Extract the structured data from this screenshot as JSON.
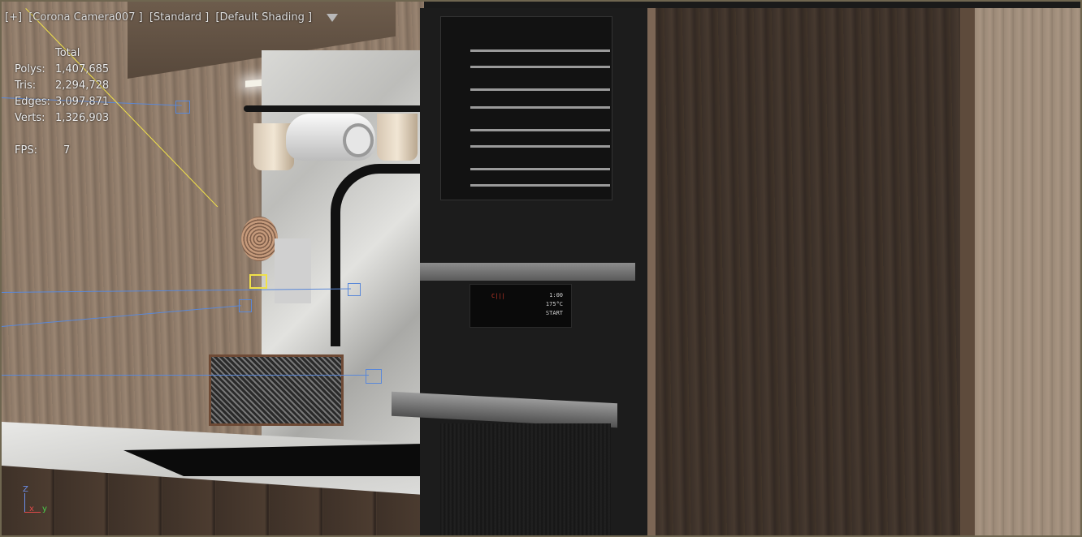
{
  "viewport": {
    "label_segments": [
      "[+]",
      "[Corona Camera007 ]",
      "[Standard ]",
      "[Default Shading ]"
    ],
    "filter_icon": "funnel-icon"
  },
  "stats": {
    "header": "Total",
    "rows": [
      {
        "label": "Polys:",
        "value": "1,407,685"
      },
      {
        "label": "Tris:",
        "value": "2,294,728"
      },
      {
        "label": "Edges:",
        "value": "3,097,871"
      },
      {
        "label": "Verts:",
        "value": "1,326,903"
      }
    ],
    "fps": {
      "label": "FPS:",
      "value": "7"
    }
  },
  "oven_display": {
    "left_text": "C|||",
    "right_lines": [
      "1:00",
      "175°C",
      "START"
    ]
  },
  "axis_tripod": {
    "z": "Z",
    "x": "x",
    "y": "y"
  },
  "colors": {
    "selection_wire": "#5a88d8",
    "camera_target": "#f0e14a",
    "viewport_border": "#6f6650"
  }
}
